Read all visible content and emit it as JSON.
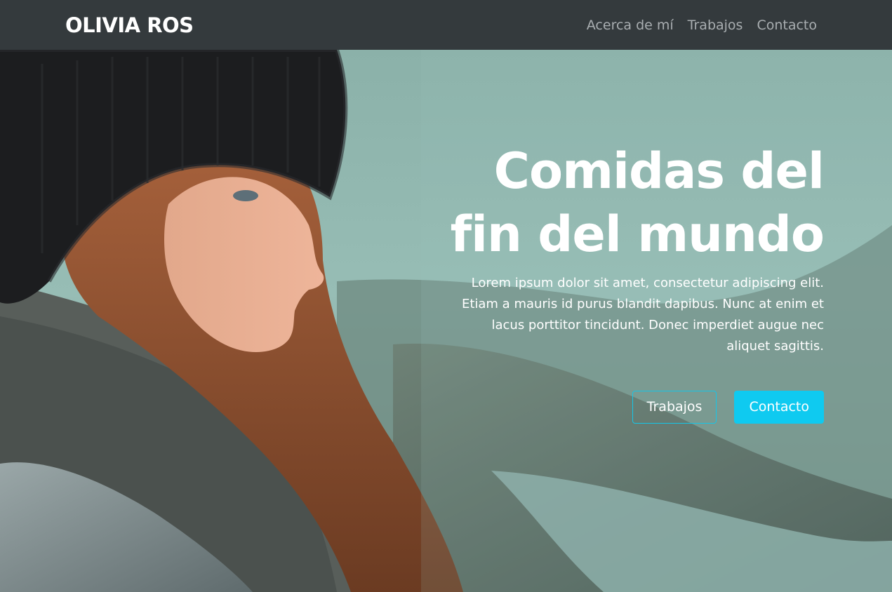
{
  "navbar": {
    "brand": "OLIVIA ROS",
    "links": [
      {
        "label": "Acerca de mí"
      },
      {
        "label": "Trabajos"
      },
      {
        "label": "Contacto"
      }
    ]
  },
  "hero": {
    "title_line1": "Comidas del",
    "title_line2": "fin del mundo",
    "text": "Lorem ipsum dolor sit amet, consectetur adipiscing elit. Etiam a mauris id purus blandit dapibus. Nunc at enim et lacus porttitor tincidunt. Donec imperdiet augue nec aliquet sagittis.",
    "buttons": {
      "primary_outline": "Trabajos",
      "primary_solid": "Contacto"
    }
  },
  "colors": {
    "navbar_bg": "#343a3d",
    "accent": "#0fcaf0",
    "nav_link": "#a9aeb1"
  }
}
